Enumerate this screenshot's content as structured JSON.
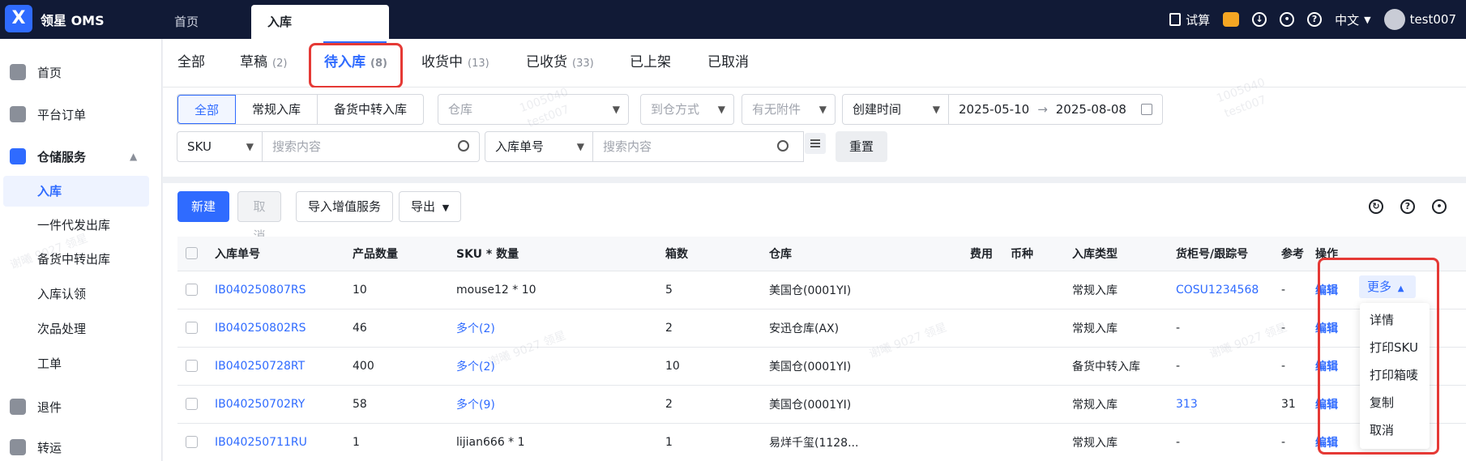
{
  "header": {
    "brand": "领星 OMS",
    "tabs": [
      {
        "label": "首页"
      },
      {
        "label": "入库"
      }
    ],
    "calc_label": "试算",
    "language": "中文",
    "username": "test007"
  },
  "sidebar": {
    "items": [
      {
        "label": "首页"
      },
      {
        "label": "平台订单"
      },
      {
        "label": "仓储服务"
      },
      {
        "label": "退件"
      },
      {
        "label": "转运"
      }
    ],
    "sub_items": [
      {
        "label": "入库"
      },
      {
        "label": "一件代发出库"
      },
      {
        "label": "备货中转出库"
      },
      {
        "label": "入库认领"
      },
      {
        "label": "次品处理"
      },
      {
        "label": "工单"
      }
    ]
  },
  "status_tabs": [
    {
      "label": "全部",
      "count": ""
    },
    {
      "label": "草稿",
      "count": "(2)"
    },
    {
      "label": "待入库",
      "count": "(8)"
    },
    {
      "label": "收货中",
      "count": "(13)"
    },
    {
      "label": "已收货",
      "count": "(33)"
    },
    {
      "label": "已上架",
      "count": ""
    },
    {
      "label": "已取消",
      "count": ""
    }
  ],
  "filters": {
    "type_segments": [
      {
        "label": "全部"
      },
      {
        "label": "常规入库"
      },
      {
        "label": "备货中转入库"
      }
    ],
    "warehouse_placeholder": "仓库",
    "arrival_placeholder": "到仓方式",
    "attachment_placeholder": "有无附件",
    "time_type": "创建时间",
    "date_start": "2025-05-10",
    "date_end": "2025-08-08",
    "sku_field": "SKU",
    "sku_search_placeholder": "搜索内容",
    "order_field": "入库单号",
    "order_search_placeholder": "搜索内容",
    "reset_label": "重置"
  },
  "toolbar": {
    "new_label": "新建",
    "cancel_label": "取消",
    "import_label": "导入增值服务",
    "export_label": "导出"
  },
  "table": {
    "columns": [
      "入库单号",
      "产品数量",
      "SKU * 数量",
      "箱数",
      "仓库",
      "费用",
      "币种",
      "入库类型",
      "货柜号/跟踪号",
      "参考",
      "操作"
    ],
    "rows": [
      {
        "order_no": "IB040250807RS",
        "qty": "10",
        "sku": "mouse12 * 10",
        "boxes": "5",
        "warehouse": "美国仓(0001YI)",
        "fee": "",
        "currency": "",
        "type": "常规入库",
        "tracking": "COSU1234568",
        "ref": "-",
        "edit": "编辑"
      },
      {
        "order_no": "IB040250802RS",
        "qty": "46",
        "sku": "多个(2)",
        "boxes": "2",
        "warehouse": "安迅仓库(AX)",
        "fee": "",
        "currency": "",
        "type": "常规入库",
        "tracking": "-",
        "ref": "-",
        "edit": "编辑"
      },
      {
        "order_no": "IB040250728RT",
        "qty": "400",
        "sku": "多个(2)",
        "boxes": "10",
        "warehouse": "美国仓(0001YI)",
        "fee": "",
        "currency": "",
        "type": "备货中转入库",
        "tracking": "-",
        "ref": "-",
        "edit": "编辑"
      },
      {
        "order_no": "IB040250702RY",
        "qty": "58",
        "sku": "多个(9)",
        "boxes": "2",
        "warehouse": "美国仓(0001YI)",
        "fee": "",
        "currency": "",
        "type": "常规入库",
        "tracking": "313",
        "ref": "31",
        "edit": "编辑"
      },
      {
        "order_no": "IB040250711RU",
        "qty": "1",
        "sku": "lijian666 * 1",
        "boxes": "1",
        "warehouse": "易烊千玺(1128...",
        "fee": "",
        "currency": "",
        "type": "常规入库",
        "tracking": "-",
        "ref": "-",
        "edit": "编辑"
      }
    ]
  },
  "more_menu": {
    "label": "更多",
    "items": [
      "详情",
      "打印SKU",
      "打印箱唛",
      "复制",
      "取消"
    ]
  },
  "watermark_text": [
    "1005040",
    "test007",
    "谢曦 9027 领星"
  ],
  "colors": {
    "primary": "#2f6bff",
    "topbar": "#111a36",
    "highlight": "#e53935"
  }
}
